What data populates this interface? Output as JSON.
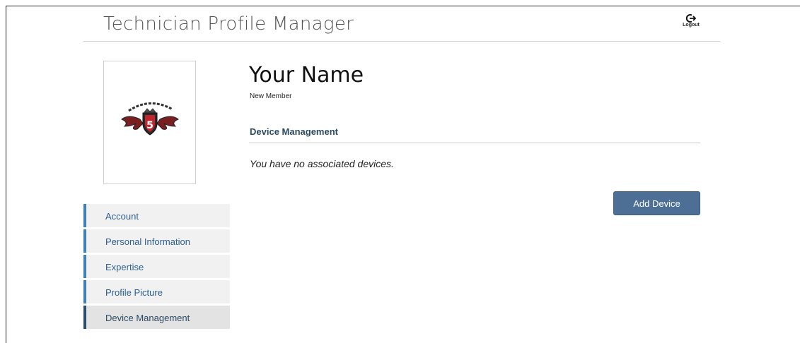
{
  "header": {
    "title": "Technician Profile Manager",
    "logout_label": "Logout",
    "logout_icon": "logout-icon"
  },
  "profile": {
    "name": "Your Name",
    "status": "New Member",
    "logo_icon": "performance-is-king-logo"
  },
  "main": {
    "section_heading": "Device Management",
    "empty_message": "You have no associated devices.",
    "add_button_label": "Add Device"
  },
  "sidebar": {
    "items": [
      {
        "label": "Account"
      },
      {
        "label": "Personal Information"
      },
      {
        "label": "Expertise"
      },
      {
        "label": "Profile Picture"
      },
      {
        "label": "Device Management",
        "active": true
      }
    ]
  },
  "colors": {
    "accent": "#3f7fb5",
    "button": "#4d6f95",
    "heading": "#2b4a63"
  }
}
